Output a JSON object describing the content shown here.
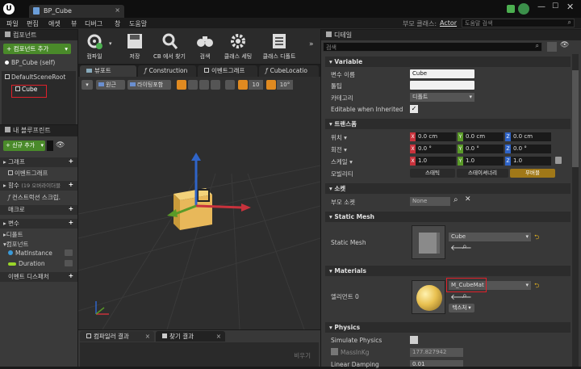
{
  "window": {
    "tab_title": "BP_Cube",
    "parent_class_label": "부모 클래스:",
    "parent_class_value": "Actor",
    "help_search_placeholder": "도움말 검색"
  },
  "menu": [
    "파일",
    "편집",
    "애셋",
    "뷰",
    "디버그",
    "창",
    "도움말"
  ],
  "toolbar": {
    "compile": "컴파일",
    "save": "저장",
    "find_in_cb": "CB 에서 찾기",
    "search": "검색",
    "class_settings": "클래스 세팅",
    "class_defaults": "클래스 디폴트",
    "more": "»"
  },
  "components": {
    "header": "컴포넌트",
    "add_button": "+ 컴포넌트 추가",
    "self_item": "BP_Cube (self)",
    "root_item": "DefaultSceneRoot",
    "child_item": "Cube"
  },
  "my_blueprint": {
    "header": "내 블루프린트",
    "add_new": "+ 신규 추가",
    "search_placeholder": "",
    "graph": "그래프",
    "event_graph": "이벤트그래프",
    "functions": "함수",
    "functions_count": "(19 오버라이더블",
    "construction_script": "컨스트럭션 스크립.",
    "macros": "매크로",
    "variables": "변수",
    "default_cat": "디폴트",
    "component_cat": "컴포넌트",
    "var1": "MatInstance",
    "var2": "Duration",
    "event_dispatchers": "이벤트 디스패처"
  },
  "tabs": {
    "viewport": "뷰포트",
    "construction": "Construction",
    "event_graph": "이벤트그래프",
    "cube_location": "CubeLocatio"
  },
  "viewport_toolbar": {
    "perspective": "원근",
    "lit": "라이팅포함",
    "grid_snap": "10",
    "rot_snap": "10°"
  },
  "bottom": {
    "compiler_results": "컴파일러 결과",
    "find_results": "찾기 결과",
    "clear": "비우기"
  },
  "details": {
    "header": "디테일",
    "search_placeholder": "검색",
    "variable_section": "Variable",
    "var_name_label": "변수 이름",
    "var_name_value": "Cube",
    "tooltip_label": "툴팁",
    "category_label": "카테고리",
    "category_value": "디폴트",
    "editable_label": "Editable when Inherited",
    "transform_section": "트랜스폼",
    "location_label": "위치 ▾",
    "rotation_label": "회전 ▾",
    "scale_label": "스케일 ▾",
    "mobility_label": "모빌리티",
    "loc": [
      "0.0 cm",
      "0.0 cm",
      "0.0 cm"
    ],
    "rot": [
      "0.0 °",
      "0.0 °",
      "0.0 °"
    ],
    "scale": [
      "1.0",
      "1.0",
      "1.0"
    ],
    "axes": [
      "X",
      "Y",
      "Z"
    ],
    "mobility": [
      "스태틱",
      "스테이셔너리",
      "무버블"
    ],
    "socket_section": "소켓",
    "parent_socket_label": "부모 소켓",
    "parent_socket_value": "None",
    "static_mesh_section": "Static Mesh",
    "static_mesh_label": "Static Mesh",
    "static_mesh_value": "Cube",
    "materials_section": "Materials",
    "element0_label": "엘리먼트 0",
    "material_value": "M_CubeMat",
    "texture_label": "텍스처 ▾",
    "physics_section": "Physics",
    "simulate_label": "Simulate Physics",
    "mass_label": "MassInKg",
    "mass_value": "177.827942",
    "linear_damping_label": "Linear Damping",
    "linear_damping_value": "0.01"
  },
  "colors": {
    "x_axis": "#c8323c",
    "y_axis": "#5a9a28",
    "z_axis": "#2f64c8",
    "highlight": "#e0202a",
    "add_green": "#4a8a2a"
  }
}
